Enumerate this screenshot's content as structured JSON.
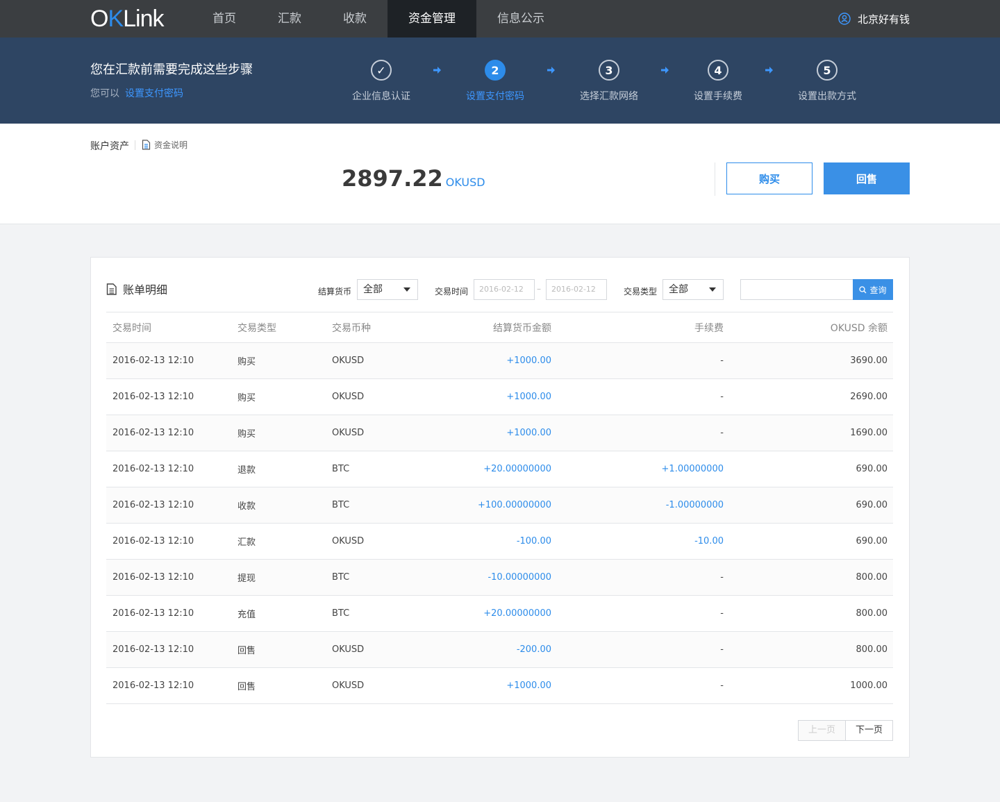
{
  "nav": {
    "logo_ok": "O",
    "logo_k": "K",
    "logo_link": "Link",
    "items": [
      {
        "label": "首页"
      },
      {
        "label": "汇款"
      },
      {
        "label": "收款"
      },
      {
        "label": "资金管理"
      },
      {
        "label": "信息公示"
      }
    ],
    "active_index": 3,
    "user": "北京好有钱"
  },
  "banner": {
    "title": "您在汇款前需要完成这些步骤",
    "sub_prefix": "您可以",
    "sub_link": "设置支付密码",
    "steps": [
      {
        "num": "✓",
        "label": "企业信息认证",
        "state": "done"
      },
      {
        "num": "2",
        "label": "设置支付密码",
        "state": "current"
      },
      {
        "num": "3",
        "label": "选择汇款网络",
        "state": "todo"
      },
      {
        "num": "4",
        "label": "设置手续费",
        "state": "todo"
      },
      {
        "num": "5",
        "label": "设置出款方式",
        "state": "todo"
      }
    ]
  },
  "account": {
    "tab": "账户资产",
    "doc_link": "资金说明",
    "balance": "2897.22",
    "unit": "OKUSD",
    "buy": "购买",
    "sell": "回售"
  },
  "bill": {
    "title": "账单明细",
    "currency_label": "结算货币",
    "currency_value": "全部",
    "time_label": "交易时间",
    "date_from": "2016-02-12",
    "date_sep": "–",
    "date_to": "2016-02-12",
    "type_label": "交易类型",
    "type_value": "全部",
    "search_placeholder": "",
    "search_btn": "查询",
    "columns": [
      "交易时间",
      "交易类型",
      "交易币种",
      "结算货币金额",
      "手续费",
      "OKUSD 余额"
    ],
    "rows": [
      {
        "time": "2016-02-13  12:10",
        "type": "购买",
        "coin": "OKUSD",
        "amount": "+1000.00",
        "fee": "-",
        "balance": "3690.00"
      },
      {
        "time": "2016-02-13  12:10",
        "type": "购买",
        "coin": "OKUSD",
        "amount": "+1000.00",
        "fee": "-",
        "balance": "2690.00"
      },
      {
        "time": "2016-02-13  12:10",
        "type": "购买",
        "coin": "OKUSD",
        "amount": "+1000.00",
        "fee": "-",
        "balance": "1690.00"
      },
      {
        "time": "2016-02-13  12:10",
        "type": "退款",
        "coin": "BTC",
        "amount": "+20.00000000",
        "fee": "+1.00000000",
        "balance": "690.00"
      },
      {
        "time": "2016-02-13  12:10",
        "type": "收款",
        "coin": "BTC",
        "amount": "+100.00000000",
        "fee": "-1.00000000",
        "balance": "690.00"
      },
      {
        "time": "2016-02-13  12:10",
        "type": "汇款",
        "coin": "OKUSD",
        "amount": "-100.00",
        "fee": "-10.00",
        "balance": "690.00"
      },
      {
        "time": "2016-02-13  12:10",
        "type": "提现",
        "coin": "BTC",
        "amount": "-10.00000000",
        "fee": "-",
        "balance": "800.00"
      },
      {
        "time": "2016-02-13  12:10",
        "type": "充值",
        "coin": "BTC",
        "amount": "+20.00000000",
        "fee": "-",
        "balance": "800.00"
      },
      {
        "time": "2016-02-13  12:10",
        "type": "回售",
        "coin": "OKUSD",
        "amount": "-200.00",
        "fee": "-",
        "balance": "800.00"
      },
      {
        "time": "2016-02-13  12:10",
        "type": "回售",
        "coin": "OKUSD",
        "amount": "+1000.00",
        "fee": "-",
        "balance": "1000.00"
      }
    ],
    "prev": "上一页",
    "next": "下一页"
  },
  "colors": {
    "accent": "#2d8cea",
    "nav_bg": "#3b3e41",
    "banner_bg": "#2e4563"
  }
}
